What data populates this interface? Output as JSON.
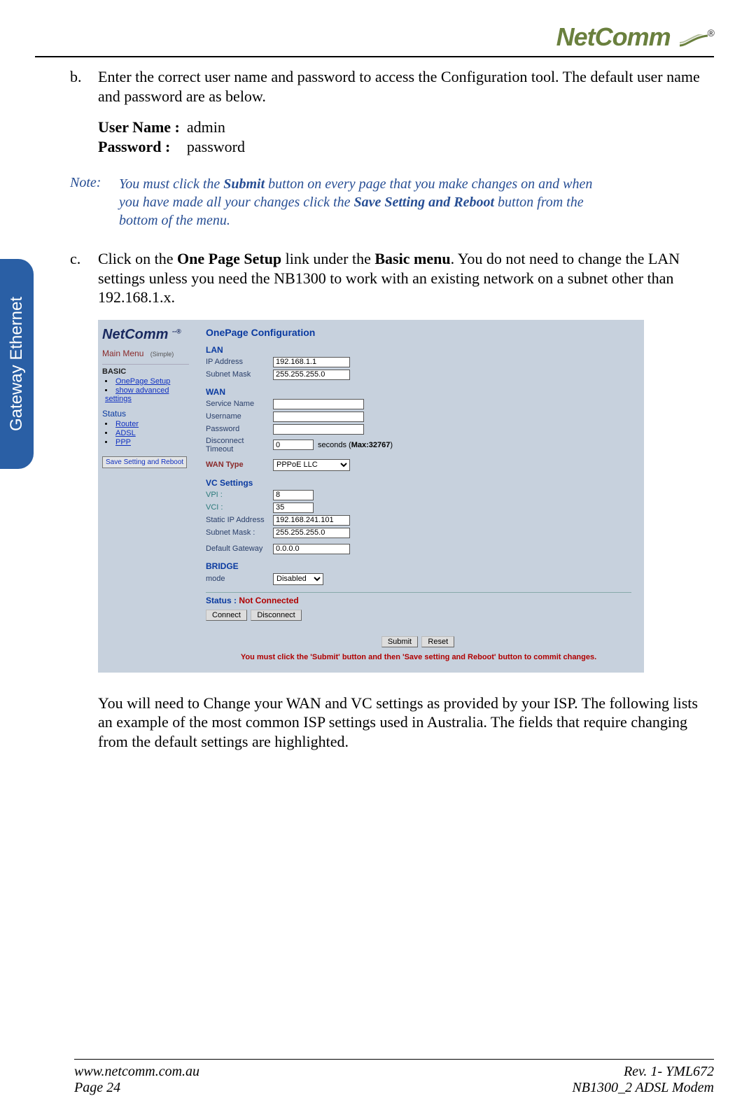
{
  "header": {
    "brand": "NetComm"
  },
  "side_tab": "Gateway Ethernet",
  "item_b": {
    "marker": "b.",
    "text": "Enter the correct user name and password to access the Configuration tool. The default user name and password are as below."
  },
  "credentials": {
    "user_label": "User Name :",
    "user_value": "admin",
    "pass_label": "Password :",
    "pass_value": "password"
  },
  "note": {
    "label": "Note:",
    "pre": "You must click the ",
    "em1": "Submit",
    "mid": " button on every page that you make changes on and when you have made all your changes click the ",
    "em2": "Save Setting and Reboot",
    "post": " button from the bottom of the menu."
  },
  "item_c": {
    "marker": "c.",
    "pre": "Click on the ",
    "b1": "One Page Setup",
    "mid1": " link under the ",
    "b2": "Basic menu",
    "post": ".  You do not need to change the LAN settings unless you need the NB1300 to work with an existing network on a subnet other than 192.168.1.x."
  },
  "screenshot": {
    "brand": "NetComm",
    "main_menu": "Main Menu",
    "main_menu_simple": "(Simple)",
    "basic_head": "BASIC",
    "basic_items": [
      {
        "label": "OnePage Setup"
      },
      {
        "label": "show advanced settings"
      }
    ],
    "status_head": "Status",
    "status_items": [
      {
        "label": "Router"
      },
      {
        "label": "ADSL"
      },
      {
        "label": "PPP"
      }
    ],
    "save_btn": "Save Setting and Reboot",
    "title": "OnePage Configuration",
    "lan": {
      "head": "LAN",
      "ip_label": "IP Address",
      "ip_value": "192.168.1.1",
      "mask_label": "Subnet Mask",
      "mask_value": "255.255.255.0"
    },
    "wan": {
      "head": "WAN",
      "service_label": "Service Name",
      "service_value": "",
      "user_label": "Username",
      "user_value": "",
      "pass_label": "Password",
      "pass_value": "",
      "disc_label": "Disconnect Timeout",
      "disc_value": "0",
      "disc_suffix": "seconds (",
      "disc_max": "Max:32767",
      "disc_suffix2": ")",
      "type_label": "WAN Type",
      "type_value": "PPPoE LLC"
    },
    "vc": {
      "head": "VC Settings",
      "vpi_label": "VPI :",
      "vpi_value": "8",
      "vci_label": "VCI :",
      "vci_value": "35",
      "sip_label": "Static IP Address",
      "sip_value": "192.168.241.101",
      "mask_label": "Subnet Mask :",
      "mask_value": "255.255.255.0",
      "gw_label": "Default Gateway",
      "gw_value": "0.0.0.0"
    },
    "bridge": {
      "head": "BRIDGE",
      "mode_label": "mode",
      "mode_value": "Disabled"
    },
    "status": {
      "label": "Status : ",
      "value": "Not Connected"
    },
    "btn_connect": "Connect",
    "btn_disconnect": "Disconnect",
    "btn_submit": "Submit",
    "btn_reset": "Reset",
    "commit_msg": "You must click the 'Submit' button and then 'Save setting and Reboot' button to commit changes."
  },
  "follow_text": "You will need to Change your WAN and VC settings as provided by your ISP. The following lists an example of the most common ISP settings used in Australia.  The fields that require changing from the default settings are highlighted.",
  "footer": {
    "url": "www.netcomm.com.au",
    "rev": "Rev. 1- YML672",
    "page": "Page 24",
    "product": "NB1300_2 ADSL Modem"
  }
}
